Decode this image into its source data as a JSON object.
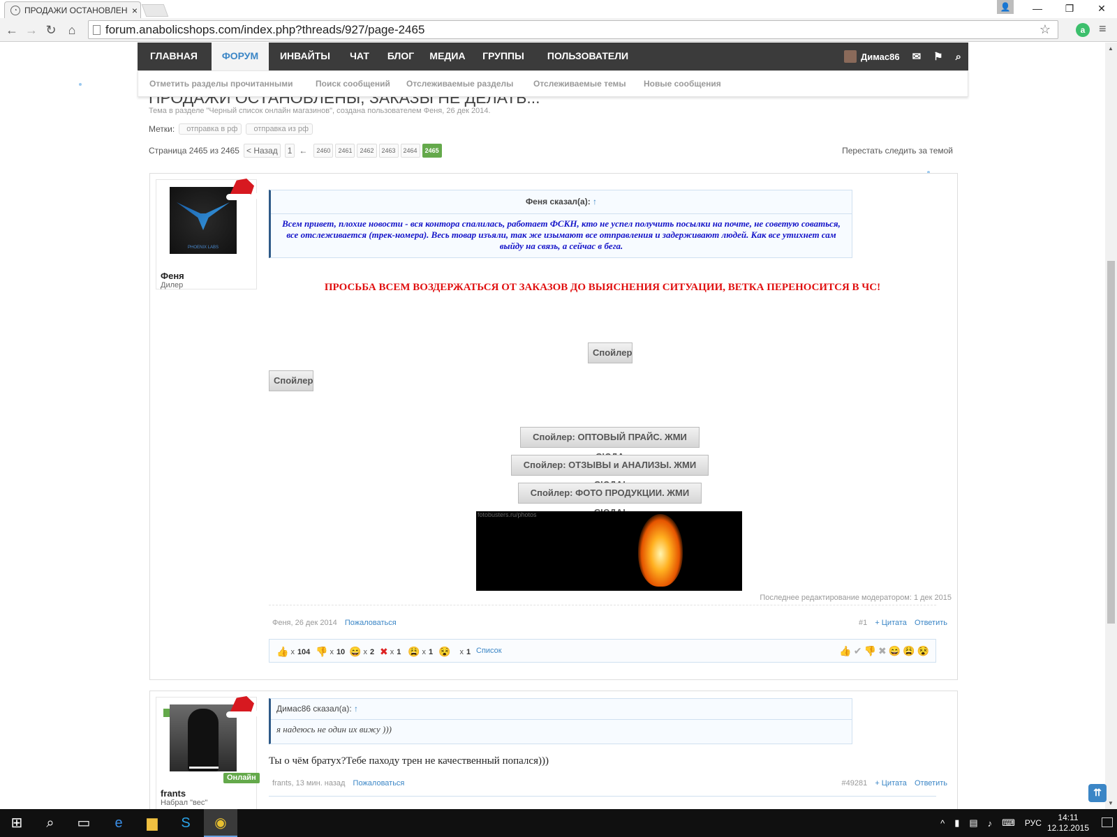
{
  "browser": {
    "tab_title": "ПРОДАЖИ ОСТАНОВЛЕН",
    "tab_close": "×",
    "url": "forum.anabolicshops.com/index.php?threads/927/page-2465",
    "win_min": "—",
    "win_restore": "❐",
    "win_close": "✕"
  },
  "nav": {
    "main": [
      {
        "label": "ГЛАВНАЯ"
      },
      {
        "label": "ФОРУМ"
      },
      {
        "label": "ИНВАЙТЫ"
      },
      {
        "label": "ЧАТ"
      },
      {
        "label": "БЛОГ"
      },
      {
        "label": "МЕДИА"
      },
      {
        "label": "ГРУППЫ"
      },
      {
        "label": "ПОЛЬЗОВАТЕЛИ"
      }
    ],
    "username": "Димас86",
    "sub": [
      {
        "label": "Отметить разделы прочитанными"
      },
      {
        "label": "Поиск сообщений"
      },
      {
        "label": "Отслеживаемые разделы"
      },
      {
        "label": "Отслеживаемые темы"
      },
      {
        "label": "Новые сообщения"
      }
    ]
  },
  "thread": {
    "title_peek": "ПРОДАЖИ ОСТАНОВЛЕНЫ, ЗАКАЗЫ НЕ ДЕЛАТЬ...",
    "description": "Тема в разделе \"Черный список онлайн магазинов\", создана пользователем Феня, 26 дек 2014.",
    "tags_label": "Метки:",
    "tags": [
      "отправка в рф",
      "отправка из рф"
    ],
    "page_info": "Страница 2465 из 2465",
    "prev": "< Назад",
    "first": "1",
    "ellipsis": "←",
    "pages": [
      "2460",
      "2461",
      "2462",
      "2463",
      "2464",
      "2465"
    ],
    "unwatch": "Перестать следить за темой"
  },
  "post1": {
    "username": "Феня",
    "user_title": "Дилер",
    "avatar_text": "PHOENIX LABS",
    "quote_author": "Феня сказал(а):",
    "quote_arrow": "↑",
    "quote_text": "Всем привет, плохие новости - вся контора спалилась, работает ФСКН, кто не успел получить посылки на почте, не советую соваться, все отслеживается (трек-номера). Весь товар изъяли, так же изымают все отправления и задерживают людей. Как все утихнет сам выйду на связь, а сейчас в бега.",
    "warning": "ПРОСЬБА ВСЕМ ВОЗДЕРЖАТЬСЯ ОТ ЗАКАЗОВ ДО ВЫЯСНЕНИЯ СИТУАЦИИ, ВЕТКА ПЕРЕНОСИТСЯ В ЧС!",
    "spoilers": [
      "Спойлер",
      "Спойлер",
      "Спойлер: ОПТОВЫЙ ПРАЙС. ЖМИ СЮДА",
      "Спойлер: ОТЗЫВЫ и АНАЛИЗЫ. ЖМИ СЮДА!",
      "Спойлер: ФОТО ПРОДУКЦИИ. ЖМИ СЮДА!"
    ],
    "image_caption": "fotobusters.ru/photos",
    "last_edit": "Последнее редактирование модератором: 1 дек 2015",
    "meta": "Феня, 26 дек 2014",
    "report": "Пожаловаться",
    "post_num": "#1",
    "quote_btn": "+ Цитата",
    "reply_btn": "Ответить",
    "likes": [
      {
        "icon": "👍",
        "count": "104"
      },
      {
        "icon": "👎",
        "count": "10"
      },
      {
        "icon": "😄",
        "count": "2"
      },
      {
        "icon": "✖",
        "count": "1"
      },
      {
        "icon": "😩",
        "count": "1"
      },
      {
        "icon": "😵",
        "count": "1"
      }
    ],
    "x_mark": "x",
    "likes_list": "Список",
    "rate_icons": "👍✔👎✖😄😩😵"
  },
  "post2": {
    "username": "frants",
    "user_title": "Набрал \"вес\"",
    "online": "Онлайн",
    "quote_author": "Димас86 сказал(а):",
    "quote_arrow": "↑",
    "quote_text": "я надеюсь не один их вижу )))",
    "reply_text": "Ты о чём братух?Тебе паходу трен не качественный попался)))",
    "meta": "frants, 13 мин. назад",
    "report": "Пожаловаться",
    "post_num": "#49281",
    "quote_btn": "+ Цитата",
    "reply_btn": "Ответить"
  },
  "taskbar": {
    "lang": "РУС",
    "time": "14:11",
    "date": "12.12.2015"
  }
}
